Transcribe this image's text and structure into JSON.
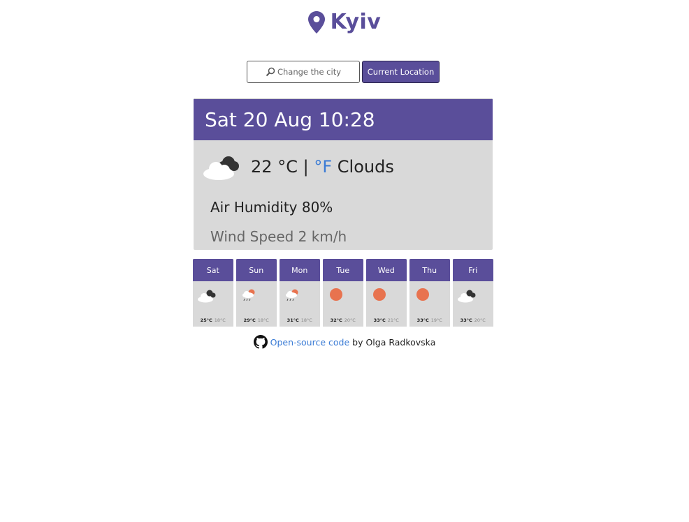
{
  "header": {
    "city": "Kyiv",
    "icon": "map-pin-icon"
  },
  "search": {
    "placeholder": "Change the city",
    "icon": "search-icon"
  },
  "location_button": {
    "label": "Current Location"
  },
  "current": {
    "datetime": "Sat 20 Aug 10:28",
    "temp": "22",
    "unit_c": "°C",
    "separator": "|",
    "unit_f": "°F",
    "description": "Clouds",
    "humidity": "Air Humidity 80%",
    "wind": "Wind Speed 2 km/h",
    "icon": "clouds-icon"
  },
  "forecast": [
    {
      "day": "Sat",
      "max": "25°C",
      "min": "18°C",
      "icon": "clouds-icon"
    },
    {
      "day": "Sun",
      "max": "29°C",
      "min": "18°C",
      "icon": "rain-sun-icon"
    },
    {
      "day": "Mon",
      "max": "31°C",
      "min": "18°C",
      "icon": "rain-sun-icon"
    },
    {
      "day": "Tue",
      "max": "32°C",
      "min": "20°C",
      "icon": "sun-icon"
    },
    {
      "day": "Wed",
      "max": "33°C",
      "min": "21°C",
      "icon": "sun-icon"
    },
    {
      "day": "Thu",
      "max": "33°C",
      "min": "19°C",
      "icon": "sun-icon"
    },
    {
      "day": "Fri",
      "max": "33°C",
      "min": "20°C",
      "icon": "clouds-icon"
    }
  ],
  "footer": {
    "link_text": "Open-source code",
    "suffix": "by Olga Radkovska",
    "icon": "github-icon"
  },
  "colors": {
    "accent": "#5a4e9a",
    "link": "#3a7bd5",
    "card": "#d9d9d9",
    "sun": "#e8734f"
  }
}
